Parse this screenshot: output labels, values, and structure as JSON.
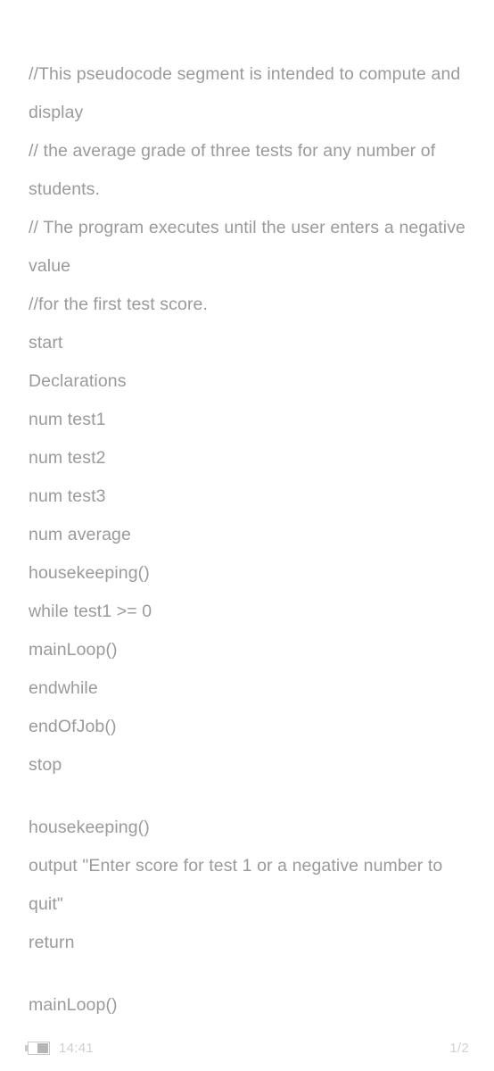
{
  "document": {
    "text_color": "#9a9a9a",
    "background_color": "#ffffff",
    "comments": [
      {
        "id": "comment-1",
        "text": "//This pseudocode segment is intended to compute and display",
        "justified": false
      },
      {
        "id": "comment-2",
        "text": "// the average grade of three tests for any number of students.",
        "justified": false
      },
      {
        "id": "comment-3",
        "text": "// The program executes until the user enters a negative value",
        "justified": true
      },
      {
        "id": "comment-4",
        "text": "//for the first test score.",
        "justified": false
      }
    ],
    "code_lines": [
      "start",
      "Declarations",
      "num test1",
      "num test2",
      "num test3",
      "num average",
      "housekeeping()",
      "while test1 >= 0",
      "mainLoop()",
      "endwhile",
      "endOfJob()",
      "stop"
    ],
    "housekeeping_block": {
      "header": "housekeeping()",
      "output_statement": "output \"Enter score for test 1 or a negative number to quit\"",
      "return_statement": "return"
    },
    "main_loop_block": {
      "header": "mainLoop()"
    }
  },
  "status_bar": {
    "battery_icon": "battery-icon",
    "time": "14:41",
    "page_indicator": "1/2"
  }
}
